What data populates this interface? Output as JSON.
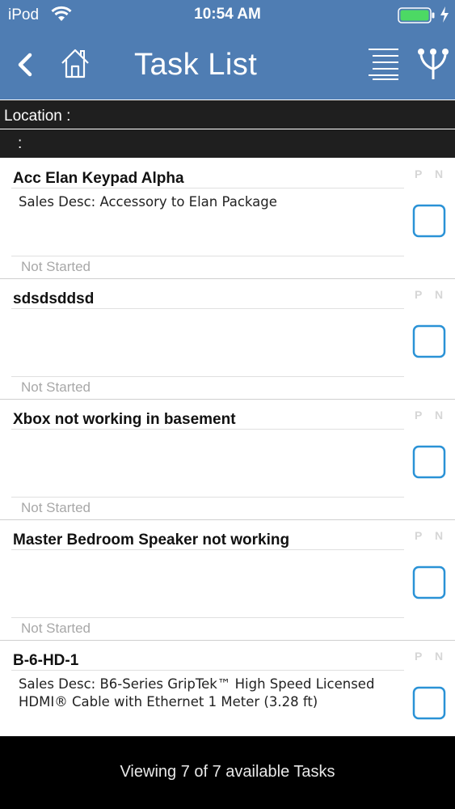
{
  "status_bar": {
    "carrier": "iPod",
    "time": "10:54 AM",
    "battery_color": "#4cd964"
  },
  "nav": {
    "title": "Task List",
    "background_color": "#4f7db3"
  },
  "location": {
    "label": "Location :",
    "sub_label": ":"
  },
  "tasks": [
    {
      "title": "Acc Elan Keypad Alpha",
      "description": "Sales Desc: Accessory to Elan Package",
      "status": "Not Started",
      "pn": "P N"
    },
    {
      "title": "sdsdsddsd",
      "description": "",
      "status": "Not Started",
      "pn": "P N"
    },
    {
      "title": "Xbox not working in basement",
      "description": "",
      "status": "Not Started",
      "pn": "P N"
    },
    {
      "title": "Master Bedroom Speaker not working",
      "description": "",
      "status": "Not Started",
      "pn": "P N"
    },
    {
      "title": "B-6-HD-1",
      "description": "Sales Desc: B6-Series GripTek™ High Speed Licensed HDMI® Cable with Ethernet 1 Meter (3.28 ft)",
      "status": "",
      "pn": "P N"
    }
  ],
  "footer": {
    "text": "Viewing 7 of 7 available Tasks"
  },
  "icons": {
    "back": "chevron-left-icon",
    "home": "home-icon",
    "list": "list-icon",
    "filter": "filter-icon",
    "checkbox": "checkbox-icon"
  },
  "colors": {
    "checkbox": "#2a92d6",
    "status_text": "#a8a8a8",
    "bar_dark": "#1f1f1f"
  }
}
